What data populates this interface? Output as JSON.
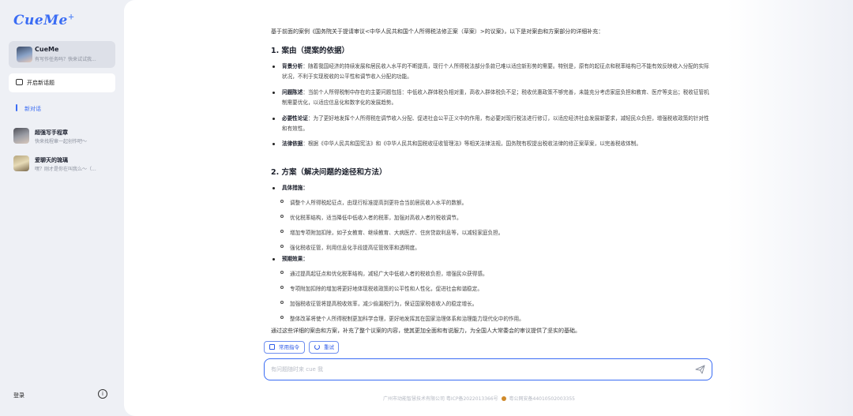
{
  "sidebar": {
    "logo": "CueMe",
    "logo_mark": "+",
    "agent": {
      "name": "CueMe",
      "subtitle": "有写作任务吗？快来试试我..."
    },
    "new_chat_label": "开启新话题",
    "section_title": "新对话",
    "history": [
      {
        "title": "超强写手程章",
        "subtitle": "快来找程章一起创作吧～"
      },
      {
        "title": "爱聊天的琉璃",
        "subtitle": "嘿？刚才是你在叫我么～（..."
      }
    ],
    "login_label": "登录",
    "info_icon": "i"
  },
  "answer": {
    "intro": "基于前面的案例《国务院关于提请审议<中华人民共和国个人所得税法修正案（草案）>的议案》，以下是对案由和方案部分的详细补充：",
    "sections": [
      {
        "heading": "1. 案由（提案的依据）",
        "bullets": [
          {
            "label": "背景分析",
            "text": "：随着我国经济的持续发展和居民收入水平的不断提高，现行个人所得税法部分条款已难以适应新形势的需要。特别是，原有的起征点和税率结构已不能有效反映收入分配的实际状况，不利于实现税收的公平性和调节收入分配的功能。"
          },
          {
            "label": "问题陈述",
            "text": "：当前个人所得税制中存在的主要问题包括：中低收入群体税负相对重，高收入群体税负不足；税收优惠政策不够完善，未能充分考虑家庭负担和教育、医疗等支出；税收征管机制需要优化，以适应信息化和数字化的发展趋势。"
          },
          {
            "label": "必要性论证",
            "text": "：为了更好地发挥个人所得税在调节收入分配、促进社会公平正义中的作用，有必要对现行税法进行修订，以适应经济社会发展新要求，减轻民众负担，增强税收政策的针对性和有效性。"
          },
          {
            "label": "法律依据",
            "text": "：根据《中华人民共和国宪法》和《中华人民共和国税收征收管理法》等相关法律法规，国务院有权提出税收法律的修正案草案，以完善税收体制。"
          }
        ]
      },
      {
        "heading": "2. 方案（解决问题的途径和方法）",
        "groups": [
          {
            "label": "具体措施",
            "items": [
              "调整个人所得税起征点，由现行标准提高到更符合当前居民收入水平的数额。",
              "优化税率结构，适当降低中低收入者的税率，加强对高收入者的税收调节。",
              "增加专项附加扣除，如子女教育、继续教育、大病医疗、住房贷款利息等，以减轻家庭负担。",
              "强化税收征管，利用信息化手段提高征管效率和透明度。"
            ]
          },
          {
            "label": "预期效果",
            "items": [
              "通过提高起征点和优化税率结构，减轻广大中低收入者的税收负担，增强民众获得感。",
              "专项附加扣除的增加将更好地体现税收政策的公平性和人性化，促进社会和谐稳定。",
              "加强税收征管将提高税收效率，减少偷漏税行为，保证国家税收收入的稳定增长。",
              "整体改革将使个人所得税制更加科学合理，更好地发挥其在国家治理体系和治理能力现代化中的作用。"
            ]
          }
        ]
      }
    ],
    "summary": "通过这些详细的案由和方案，补充了整个议案的内容，使其更加全面和有说服力，为全国人大常委会的审议提供了坚实的基础。"
  },
  "actions": {
    "commands_label": "常用指令",
    "retry_label": "重试"
  },
  "composer": {
    "placeholder": "有问题随时来 cue 我",
    "value": ""
  },
  "footer": {
    "company": "广州市动能智慧技术有限公司 粤ICP备2022013366号",
    "police": "粤公网安备44010502003355"
  },
  "colors": {
    "accent": "#3a6cf4",
    "sidebar_bg": "#eef0f5",
    "main_bg": "#ffffff"
  }
}
